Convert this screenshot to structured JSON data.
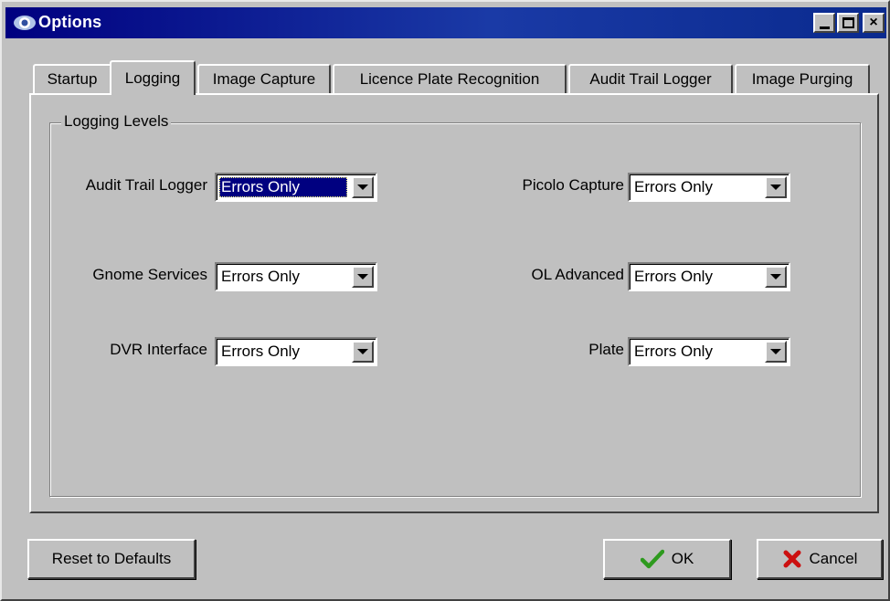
{
  "window": {
    "title": "Options",
    "minimize_icon": "minimize-icon",
    "maximize_icon": "maximize-icon",
    "close_label": "×"
  },
  "tabs": [
    {
      "label": "Startup",
      "active": false
    },
    {
      "label": "Logging",
      "active": true
    },
    {
      "label": "Image Capture",
      "active": false
    },
    {
      "label": "Licence Plate Recognition",
      "active": false
    },
    {
      "label": "Audit Trail Logger",
      "active": false
    },
    {
      "label": "Image Purging",
      "active": false
    }
  ],
  "logging": {
    "group_title": "Logging Levels",
    "fields": [
      {
        "label": "Audit Trail Logger",
        "value": "Errors Only"
      },
      {
        "label": "Gnome Services",
        "value": "Errors Only"
      },
      {
        "label": "DVR Interface",
        "value": "Errors Only"
      },
      {
        "label": "Picolo Capture",
        "value": "Errors Only"
      },
      {
        "label": "OL Advanced",
        "value": "Errors Only"
      },
      {
        "label": "Plate",
        "value": "Errors Only"
      }
    ]
  },
  "buttons": {
    "reset": "Reset to Defaults",
    "ok": "OK",
    "cancel": "Cancel"
  },
  "colors": {
    "titlebar": "#000080",
    "face": "#c0c0c0",
    "ok_check": "#2e9a1e",
    "cancel_x": "#cc1010"
  }
}
